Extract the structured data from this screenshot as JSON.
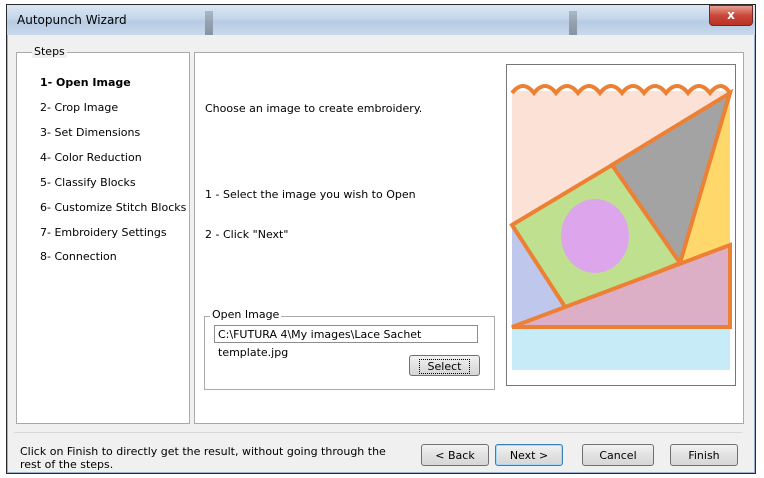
{
  "window": {
    "title": "Autopunch Wizard",
    "close_glyph": "x"
  },
  "steps": {
    "legend": "Steps",
    "items": [
      {
        "label": "1- Open Image"
      },
      {
        "label": "2- Crop Image"
      },
      {
        "label": "3- Set Dimensions"
      },
      {
        "label": "4- Color Reduction"
      },
      {
        "label": "5- Classify Blocks"
      },
      {
        "label": "6- Customize Stitch Blocks"
      },
      {
        "label": "7- Embroidery Settings"
      },
      {
        "label": "8- Connection"
      }
    ],
    "active_index": 0
  },
  "main": {
    "intro": "Choose an image to create embroidery.",
    "instruction1": "1 -  Select the image you wish to Open",
    "instruction2": "2 -  Click \"Next\""
  },
  "open_image": {
    "legend": "Open Image",
    "path_value": "C:\\FUTURA 4\\My images\\Lace Sachet template.jpg",
    "select_label": "Select"
  },
  "preview": {
    "colors": {
      "peach": "#fbe1d6",
      "orange_outline": "#ec8136",
      "gray": "#a3a3a3",
      "green": "#bfe08f",
      "lavender": "#dda6ec",
      "blue": "#bfc8ec",
      "yellow": "#ffd86b",
      "pink": "#dcafc6",
      "lightblue": "#c7ecf8"
    }
  },
  "footer": {
    "hint": "Click on Finish to directly get the result, without going through the rest of the steps.",
    "back_label": "< Back",
    "next_label": "Next >",
    "cancel_label": "Cancel",
    "finish_label": "Finish"
  }
}
